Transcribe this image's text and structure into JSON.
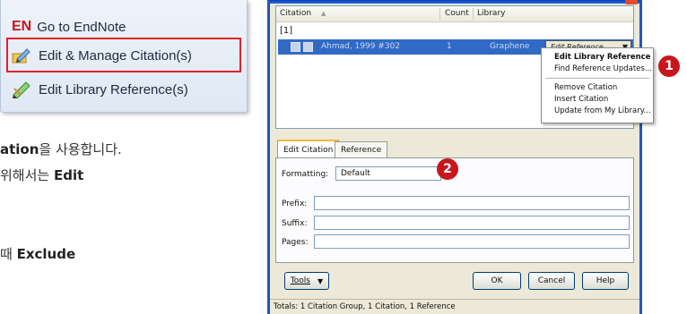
{
  "ribbon": {
    "en_logo": "EN",
    "go_to_endnote": "Go to EndNote",
    "edit_manage": "Edit & Manage Citation(s)",
    "edit_library": "Edit Library Reference(s)",
    "icons": [
      "pencil-citation-icon",
      "pencil-library-icon"
    ],
    "highlight_color": "#e0202a"
  },
  "korean_text": {
    "line1_bold": "ation",
    "line1_rest": "을 사용합니다.",
    "line2_rest": " 위해서는 ",
    "line2_bold": "Edit",
    "line3_rest": "때 ",
    "line3_bold": "Exclude"
  },
  "dialog": {
    "list": {
      "columns": [
        "Citation",
        "Count",
        "Library"
      ],
      "sort_indicator": "▲",
      "group_label": "[1]",
      "selected_row": {
        "citation": "Ahmad, 1999 #302",
        "count": "1",
        "library": "Graphene",
        "ref_button": "Edit Reference",
        "ref_button_arrow": "▼"
      }
    },
    "context_menu": {
      "items": [
        "Edit Library Reference",
        "Find Reference Updates...",
        "Remove Citation",
        "Insert Citation",
        "Update from My Library..."
      ]
    },
    "badges": [
      "1",
      "2"
    ],
    "tabs": [
      "Edit Citation",
      "Reference"
    ],
    "form": {
      "formatting_label": "Formatting:",
      "formatting_value": "Default",
      "prefix_label": "Prefix:",
      "suffix_label": "Suffix:",
      "pages_label": "Pages:"
    },
    "buttons": {
      "tools": "Tools",
      "tools_arrow": "▼",
      "ok": "OK",
      "cancel": "Cancel",
      "help": "Help"
    },
    "status": "Totals: 1 Citation Group, 1 Citation, 1 Reference",
    "colors": {
      "selection": "#316ac5",
      "badge": "#c8161d",
      "frame": "#2457b0"
    }
  }
}
